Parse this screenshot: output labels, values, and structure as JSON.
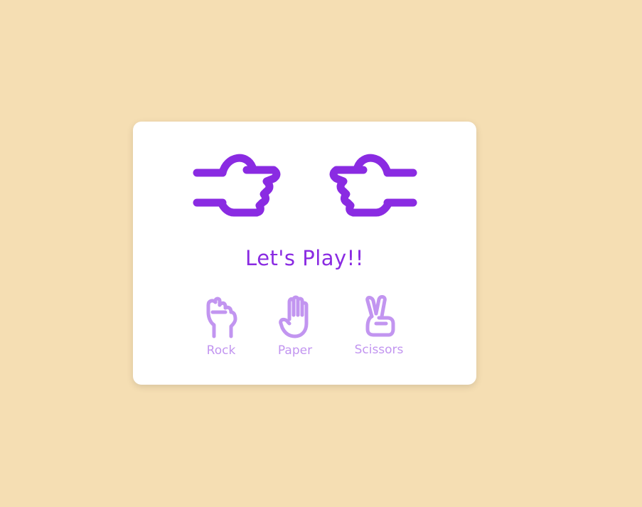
{
  "game": {
    "title": "Let's Play!!",
    "player_hand_icon": "fist-hand-icon",
    "computer_hand_icon": "fist-hand-icon"
  },
  "choices": [
    {
      "label": "Rock",
      "icon": "rock-hand-icon"
    },
    {
      "label": "Paper",
      "icon": "paper-hand-icon"
    },
    {
      "label": "Scissors",
      "icon": "scissors-hand-icon"
    }
  ],
  "colors": {
    "background": "#f5deb3",
    "accent": "#8a2be2",
    "choice": "#c295f0"
  }
}
